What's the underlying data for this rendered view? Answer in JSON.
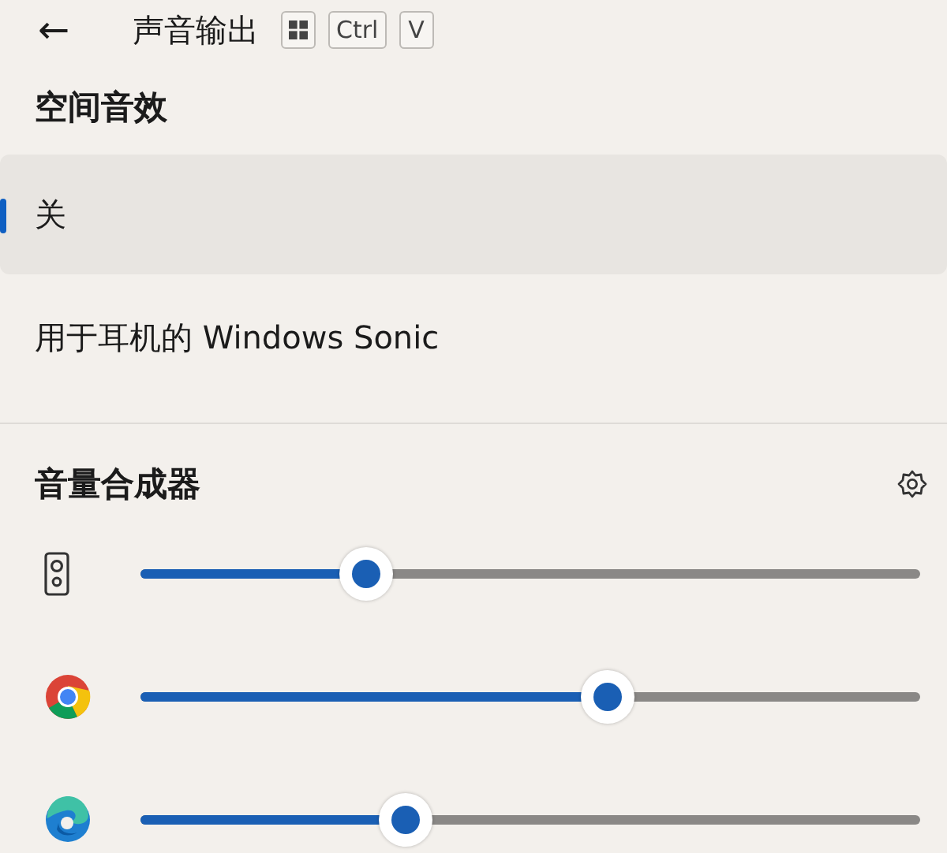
{
  "header": {
    "back": "←",
    "title": "声音输出",
    "keys": [
      {
        "kind": "win"
      },
      {
        "kind": "text",
        "label": "Ctrl"
      },
      {
        "kind": "text",
        "label": "V"
      }
    ]
  },
  "spatial": {
    "title": "空间音效",
    "options": [
      {
        "label": "关",
        "selected": true
      },
      {
        "label": "用于耳机的 Windows Sonic",
        "selected": false
      }
    ]
  },
  "mixer": {
    "title": "音量合成器",
    "apps": [
      {
        "kind": "speaker",
        "level": 0.29
      },
      {
        "kind": "chrome",
        "level": 0.6
      },
      {
        "kind": "edge",
        "level": 0.34
      }
    ]
  }
}
